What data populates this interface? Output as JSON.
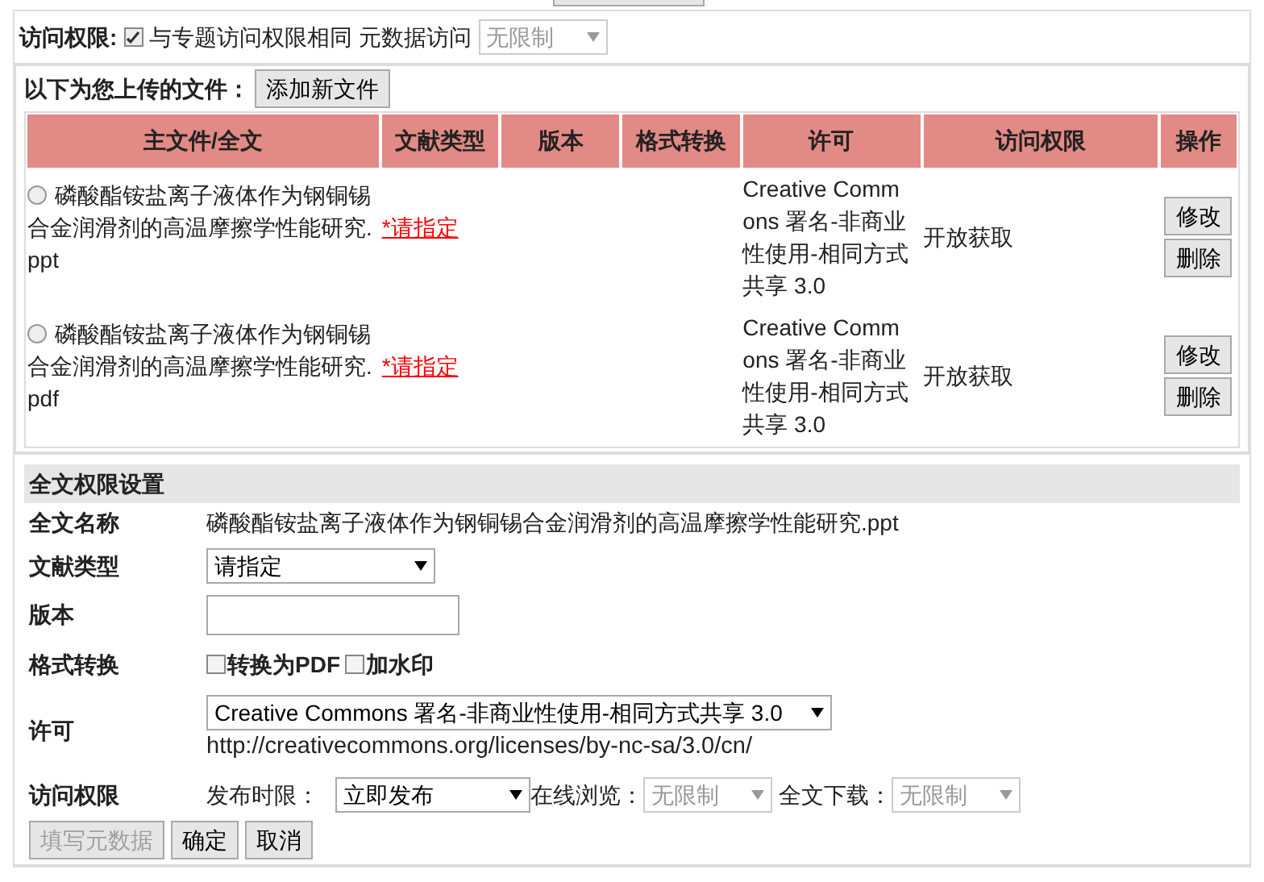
{
  "access": {
    "label": "访问权限:",
    "same_checked": true,
    "same_label": "与专题访问权限相同",
    "metadata_label": "元数据访问",
    "metadata_select": "无限制"
  },
  "files": {
    "title": "以下为您上传的文件：",
    "add_button": "添加新文件",
    "columns": [
      "主文件/全文",
      "文献类型",
      "版本",
      "格式转换",
      "许可",
      "访问权限",
      "操作"
    ],
    "rows": [
      {
        "selected": false,
        "name": "磷酸酯铵盐离子液体作为钢铜锡合金润滑剂的高温摩擦学性能研究.",
        "ext": "ppt",
        "type_link": "*请指定",
        "license": "Creative Commons 署名-非商业性使用-相同方式共享 3.0",
        "access": "开放获取",
        "actions": [
          "修改",
          "删除"
        ]
      },
      {
        "selected": false,
        "name": "磷酸酯铵盐离子液体作为钢铜锡合金润滑剂的高温摩擦学性能研究.",
        "ext": "pdf",
        "type_link": "*请指定",
        "license": "Creative Commons 署名-非商业性使用-相同方式共享 3.0",
        "access": "开放获取",
        "actions": [
          "修改",
          "删除"
        ]
      }
    ]
  },
  "settings": {
    "title": "全文权限设置",
    "name_label": "全文名称",
    "name_value": "磷酸酯铵盐离子液体作为钢铜锡合金润滑剂的高温摩擦学性能研究.ppt",
    "type_label": "文献类型",
    "type_select": "请指定",
    "version_label": "版本",
    "format_label": "格式转换",
    "format_options": [
      {
        "label": "转换为PDF",
        "checked": false
      },
      {
        "label": "加水印",
        "checked": false
      }
    ],
    "license_label": "许可",
    "license_select": "Creative Commons 署名-非商业性使用-相同方式共享 3.0",
    "license_url": "http://creativecommons.org/licenses/by-nc-sa/3.0/cn/",
    "access_label": "访问权限",
    "publish_label": "发布时限：",
    "publish_select": "立即发布",
    "online_label": "在线浏览：",
    "online_select": "无限制",
    "download_label": "全文下载：",
    "download_select": "无限制",
    "buttons": [
      {
        "label": "填写元数据",
        "disabled": true
      },
      {
        "label": "确定",
        "disabled": false
      },
      {
        "label": "取消",
        "disabled": false
      }
    ]
  }
}
